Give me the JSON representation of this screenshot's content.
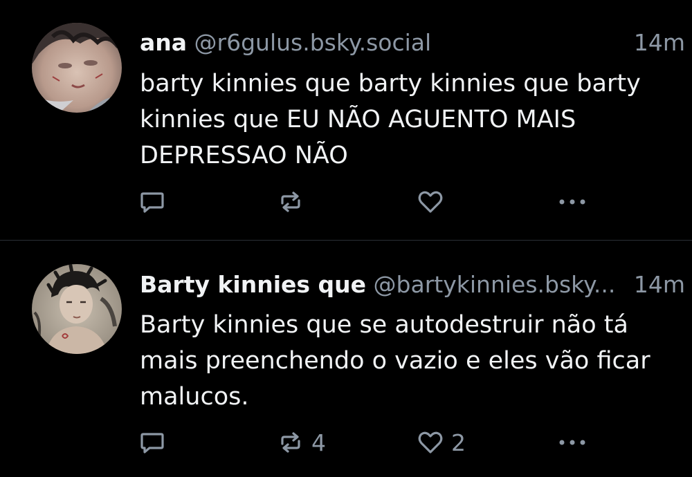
{
  "posts": [
    {
      "author": {
        "display_name": "ana",
        "handle": "@r6gulus.bsky.social"
      },
      "time": "14m",
      "text": "barty kinnies que barty kinnies que barty\nkinnies que EU NÃO AGUENTO MAIS\nDEPRESSAO NÃO",
      "counts": {
        "reposts": "",
        "likes": ""
      },
      "icons": [
        "reply-icon",
        "repost-icon",
        "heart-icon",
        "more-icon"
      ]
    },
    {
      "author": {
        "display_name": "Barty kinnies que",
        "handle": "@bartykinnies.bsky..."
      },
      "time": "14m",
      "text": "Barty kinnies que se autodestruir não tá\nmais preenchendo o vazio e eles vão ficar\nmalucos.",
      "counts": {
        "reposts": "4",
        "likes": "2"
      },
      "icons": [
        "reply-icon",
        "repost-icon",
        "heart-icon",
        "more-icon"
      ]
    }
  ],
  "colors": {
    "background": "#000000",
    "text": "#f1f3f5",
    "muted": "#8d98a5",
    "divider": "#2a2f36"
  }
}
